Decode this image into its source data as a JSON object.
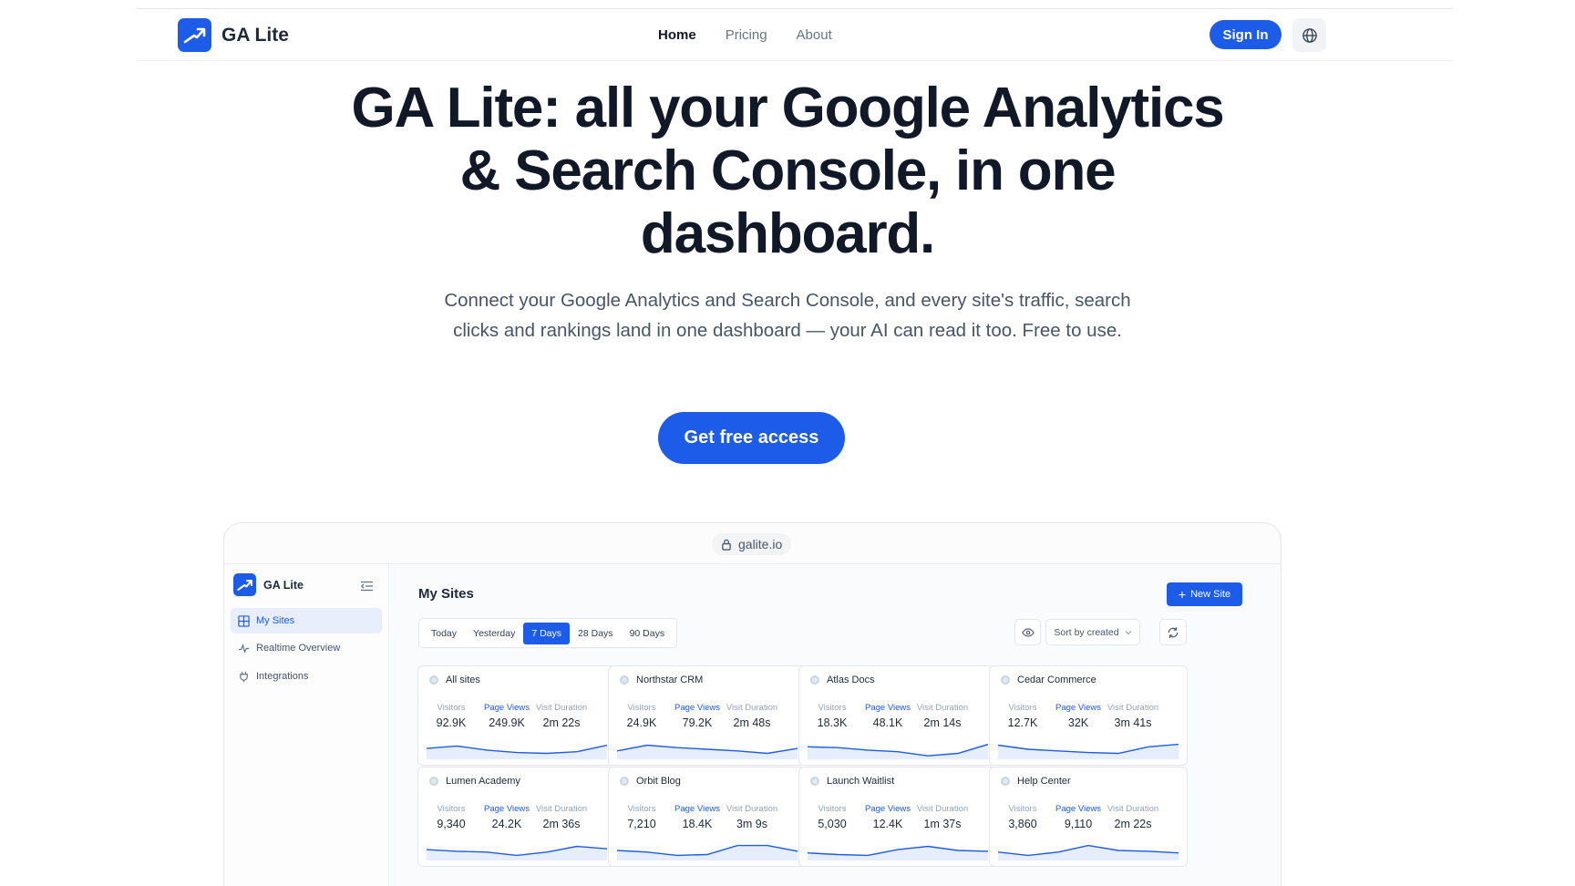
{
  "nav": {
    "brand": "GA Lite",
    "links": [
      {
        "label": "Home",
        "active": true
      },
      {
        "label": "Pricing",
        "active": false
      },
      {
        "label": "About",
        "active": false
      }
    ],
    "signin": "Sign In",
    "globe_icon": "globe-icon"
  },
  "hero": {
    "title": "GA Lite: all your Google Analytics & Search Console, in one dashboard.",
    "subtitle": "Connect your Google Analytics and Search Console, and every site's traffic, search clicks and rankings land in one dashboard — your AI can read it too. Free to use.",
    "cta": "Get free access"
  },
  "preview": {
    "url": "galite.io",
    "sidebar": {
      "brand": "GA Lite",
      "items": [
        {
          "label": "My Sites",
          "icon": "grid-icon",
          "active": true
        },
        {
          "label": "Realtime Overview",
          "icon": "activity-icon",
          "active": false
        },
        {
          "label": "Integrations",
          "icon": "plug-icon",
          "active": false
        }
      ]
    },
    "main": {
      "title": "My Sites",
      "new_site": "New Site",
      "ranges": [
        {
          "label": "Today",
          "active": false
        },
        {
          "label": "Yesterday",
          "active": false
        },
        {
          "label": "7 Days",
          "active": true
        },
        {
          "label": "28 Days",
          "active": false
        },
        {
          "label": "90 Days",
          "active": false
        }
      ],
      "sort": "Sort by created",
      "metric_labels": {
        "visitors": "Visitors",
        "page_views": "Page Views",
        "duration": "Visit Duration"
      },
      "accent": "#1d5ce8",
      "sites": [
        {
          "name": "All sites",
          "visitors": "92.9K",
          "page_views": "249.9K",
          "duration": "2m 22s",
          "trend": [
            0.55,
            0.7,
            0.45,
            0.3,
            0.25,
            0.35,
            0.75
          ]
        },
        {
          "name": "Northstar CRM",
          "visitors": "24.9K",
          "page_views": "79.2K",
          "duration": "2m 48s",
          "trend": [
            0.4,
            0.75,
            0.6,
            0.5,
            0.4,
            0.25,
            0.55
          ]
        },
        {
          "name": "Atlas Docs",
          "visitors": "18.3K",
          "page_views": "48.1K",
          "duration": "2m 14s",
          "trend": [
            0.65,
            0.6,
            0.45,
            0.35,
            0.1,
            0.25,
            0.8
          ]
        },
        {
          "name": "Cedar Commerce",
          "visitors": "12.7K",
          "page_views": "32K",
          "duration": "3m 41s",
          "trend": [
            0.75,
            0.5,
            0.4,
            0.3,
            0.25,
            0.65,
            0.8
          ]
        },
        {
          "name": "Lumen Academy",
          "visitors": "9,340",
          "page_views": "24.2K",
          "duration": "2m 36s",
          "trend": [
            0.55,
            0.45,
            0.4,
            0.2,
            0.4,
            0.75,
            0.6
          ]
        },
        {
          "name": "Orbit Blog",
          "visitors": "7,210",
          "page_views": "18.4K",
          "duration": "3m 9s",
          "trend": [
            0.5,
            0.4,
            0.2,
            0.25,
            0.8,
            0.8,
            0.45
          ]
        },
        {
          "name": "Launch Waitlist",
          "visitors": "5,030",
          "page_views": "12.4K",
          "duration": "1m 37s",
          "trend": [
            0.35,
            0.25,
            0.2,
            0.55,
            0.75,
            0.5,
            0.45
          ]
        },
        {
          "name": "Help Center",
          "visitors": "3,860",
          "page_views": "9,110",
          "duration": "2m 22s",
          "trend": [
            0.4,
            0.2,
            0.4,
            0.8,
            0.5,
            0.45,
            0.35
          ]
        }
      ]
    }
  }
}
